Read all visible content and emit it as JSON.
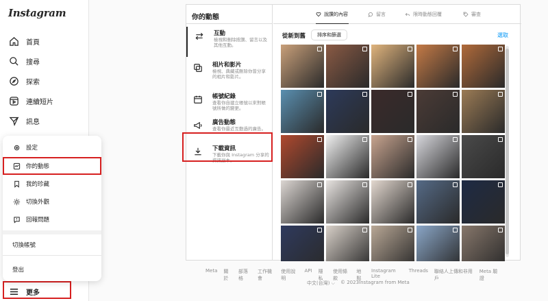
{
  "app": {
    "logo": "Instagram"
  },
  "left_nav": {
    "items": [
      {
        "label": "首頁",
        "icon": "home-icon"
      },
      {
        "label": "搜尋",
        "icon": "search-icon"
      },
      {
        "label": "探索",
        "icon": "compass-icon"
      },
      {
        "label": "連續短片",
        "icon": "reels-icon"
      },
      {
        "label": "訊息",
        "icon": "send-icon"
      }
    ],
    "more_label": "更多"
  },
  "more_menu": {
    "items": [
      {
        "label": "設定",
        "icon": "gear-icon"
      },
      {
        "label": "你的動態",
        "icon": "activity-icon"
      },
      {
        "label": "我的珍藏",
        "icon": "bookmark-icon"
      },
      {
        "label": "切換外觀",
        "icon": "sun-icon"
      },
      {
        "label": "回報問題",
        "icon": "report-icon"
      }
    ],
    "switch_accounts": "切換帳號",
    "logout": "登出"
  },
  "activity": {
    "header": "你的動態",
    "items": [
      {
        "title": "互動",
        "desc": "檢視和刪除按讚、留言以及其他互動。",
        "icon": "arrows-icon"
      },
      {
        "title": "相片和影片",
        "desc": "檢視、典藏或刪除你曾分享的相片和影片。",
        "icon": "photos-icon"
      },
      {
        "title": "帳號紀錄",
        "desc": "查看你自建立帳號以來對帳號所做的變更。",
        "icon": "calendar-icon"
      },
      {
        "title": "廣告動態",
        "desc": "查看你最近互動過的廣告。",
        "icon": "megaphone-icon"
      },
      {
        "title": "下載資訊",
        "desc": "下載你與 Instagram 分享的資訊副本。",
        "icon": "download-icon"
      }
    ]
  },
  "tabs": [
    {
      "label": "說讚的內容",
      "icon": "heart-icon",
      "active": true
    },
    {
      "label": "留言",
      "icon": "comment-icon",
      "active": false
    },
    {
      "label": "限時動態回覆",
      "icon": "reply-icon",
      "active": false
    },
    {
      "label": "審查",
      "icon": "tag-icon",
      "active": false
    }
  ],
  "sort": {
    "label": "從新到舊",
    "button": "排序和篩選",
    "select": "選取"
  },
  "grid": {
    "colors": [
      "#c9a07a",
      "#8a5a44",
      "#e0b47d",
      "#c47a46",
      "#b06a3a",
      "#5a8fb0",
      "#2c3a5a",
      "#3b2a2a",
      "#4b3b36",
      "#9b7b55",
      "#b0492e",
      "#f0f0f0",
      "#c8a48f",
      "#d7d7dc",
      "#4a4a4a",
      "#dcd6d2",
      "#e7e3e0",
      "#e3d8cf",
      "#556a86",
      "#1e2a44",
      "#2f3a5e",
      "#d8d0c8",
      "#b9a896",
      "#8aa6c7",
      "#87776b"
    ]
  },
  "footer": {
    "links": [
      "Meta",
      "關於",
      "部落格",
      "工作機會",
      "使用說明",
      "API",
      "隱私",
      "使用條款",
      "地點",
      "Instagram Lite",
      "Threads",
      "聯絡人上傳和非用戶",
      "Meta 驗證"
    ],
    "language": "中文(台灣) ⌵",
    "copyright": "© 2023Instagram from Meta"
  }
}
